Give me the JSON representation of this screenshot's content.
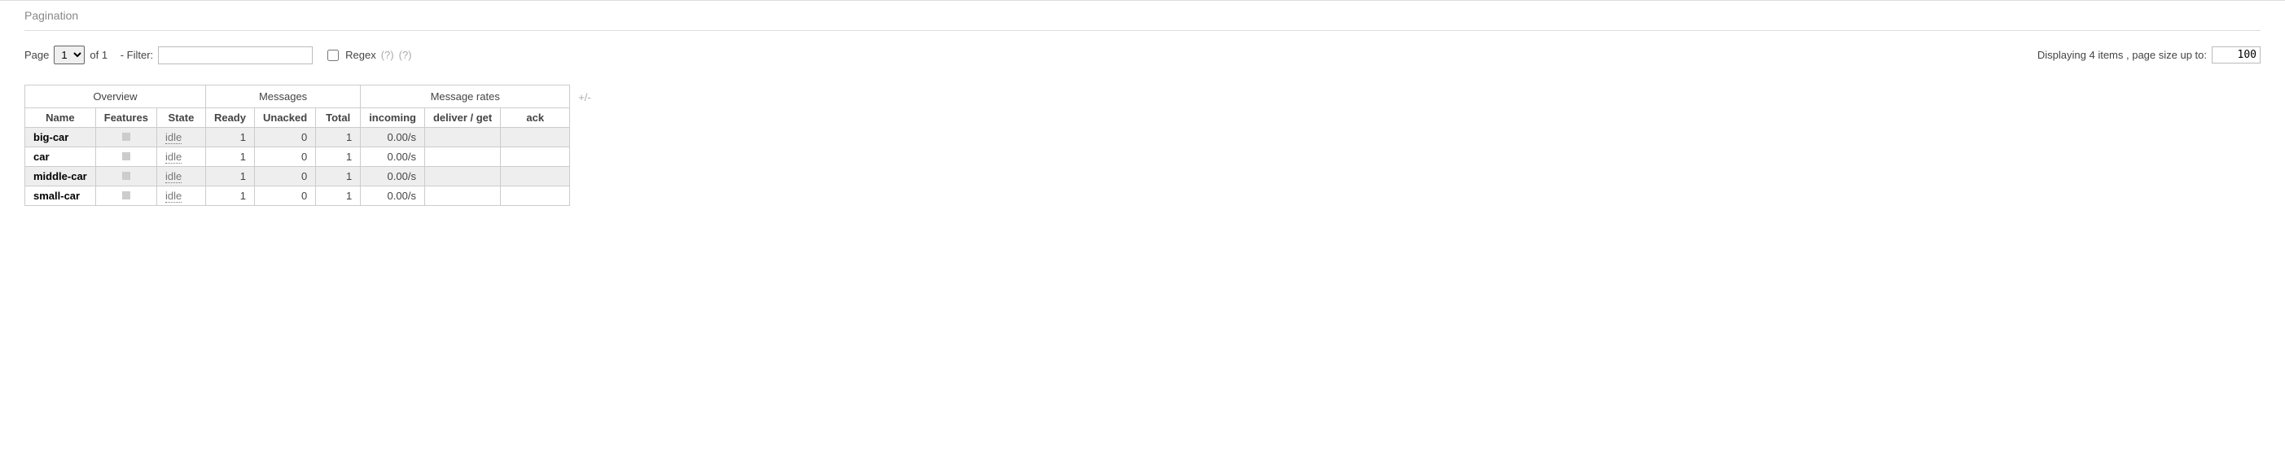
{
  "section_title": "Pagination",
  "controls": {
    "page_label": "Page",
    "page_options": [
      "1"
    ],
    "page_selected": "1",
    "of_label": "of 1",
    "filter_label": "- Filter:",
    "filter_value": "",
    "regex_label": "Regex",
    "help1": "(?)",
    "help2": "(?)",
    "display_label": "Displaying 4 items , page size up to:",
    "page_size": "100"
  },
  "table": {
    "group_headers": [
      "Overview",
      "Messages",
      "Message rates"
    ],
    "plus_minus": "+/-",
    "sub_headers": [
      "Name",
      "Features",
      "State",
      "Ready",
      "Unacked",
      "Total",
      "incoming",
      "deliver / get",
      "ack"
    ],
    "rows": [
      {
        "name": "big-car",
        "state": "idle",
        "ready": "1",
        "unacked": "0",
        "total": "1",
        "incoming": "0.00/s",
        "deliver": "",
        "ack": ""
      },
      {
        "name": "car",
        "state": "idle",
        "ready": "1",
        "unacked": "0",
        "total": "1",
        "incoming": "0.00/s",
        "deliver": "",
        "ack": ""
      },
      {
        "name": "middle-car",
        "state": "idle",
        "ready": "1",
        "unacked": "0",
        "total": "1",
        "incoming": "0.00/s",
        "deliver": "",
        "ack": ""
      },
      {
        "name": "small-car",
        "state": "idle",
        "ready": "1",
        "unacked": "0",
        "total": "1",
        "incoming": "0.00/s",
        "deliver": "",
        "ack": ""
      }
    ]
  }
}
